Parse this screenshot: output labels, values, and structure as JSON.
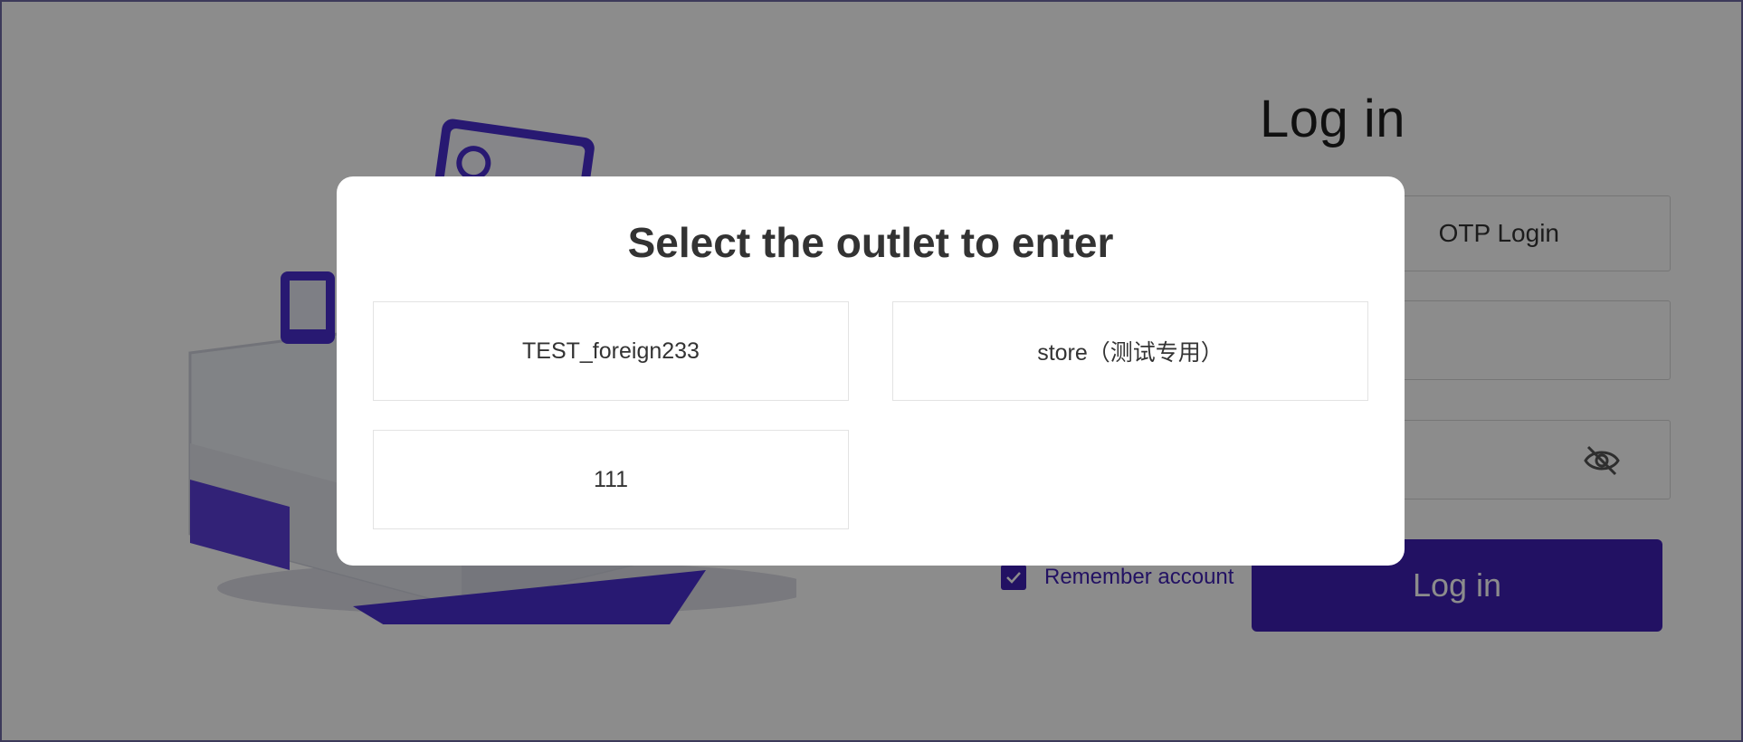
{
  "login": {
    "title": "Log in",
    "otp_tab_label": "OTP Login",
    "remember_label": "Remember account",
    "remember_checked": true,
    "button_label": "Log in"
  },
  "modal": {
    "title": "Select the outlet to enter",
    "outlets": [
      {
        "label": "TEST_foreign233"
      },
      {
        "label": "store（测试专用）"
      },
      {
        "label": "111"
      }
    ]
  },
  "colors": {
    "accent": "#3f1fb5",
    "overlay": "rgba(0,0,0,0.45)"
  },
  "icons": {
    "password_toggle": "eye-slash-icon",
    "checkbox_mark": "checkmark-icon"
  }
}
